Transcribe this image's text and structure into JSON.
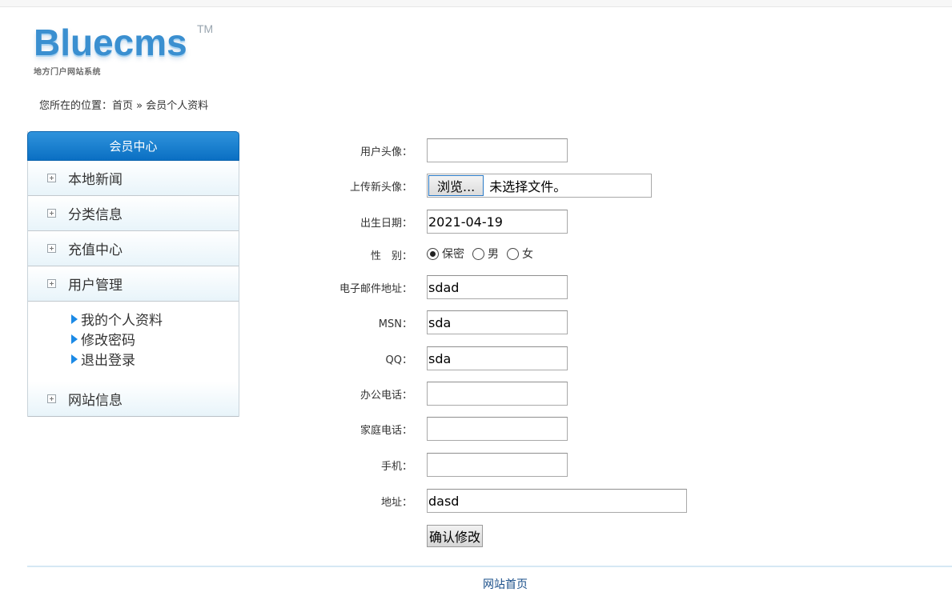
{
  "logo": {
    "word": "Bluecms",
    "tm": "TM",
    "subtitle": "地方门户网站系统"
  },
  "breadcrumb": {
    "prefix": "您所在的位置：",
    "home": "首页",
    "sep": " » ",
    "current": "会员个人资料"
  },
  "sidebar": {
    "title": "会员中心",
    "items": [
      {
        "label": "本地新闻"
      },
      {
        "label": "分类信息"
      },
      {
        "label": "充值中心"
      },
      {
        "label": "用户管理"
      }
    ],
    "sub_links": [
      {
        "label": "我的个人资料"
      },
      {
        "label": "修改密码"
      },
      {
        "label": "退出登录"
      }
    ],
    "last_item": {
      "label": "网站信息"
    }
  },
  "form": {
    "avatar": {
      "label": "用户头像：",
      "value": ""
    },
    "upload": {
      "label": "上传新头像：",
      "button": "浏览...",
      "status": "未选择文件。"
    },
    "birthday": {
      "label": "出生日期：",
      "value": "2021-04-19"
    },
    "gender": {
      "label": "性　别：",
      "options": [
        "保密",
        "男",
        "女"
      ],
      "selected": "保密"
    },
    "email": {
      "label": "电子邮件地址：",
      "value": "sdad"
    },
    "msn": {
      "label": "MSN：",
      "value": "sda"
    },
    "qq": {
      "label": "QQ：",
      "value": "sda"
    },
    "office_phone": {
      "label": "办公电话：",
      "value": ""
    },
    "home_phone": {
      "label": "家庭电话：",
      "value": ""
    },
    "mobile": {
      "label": "手机：",
      "value": ""
    },
    "address": {
      "label": "地址：",
      "value": "dasd"
    },
    "submit": "确认修改"
  },
  "footer": {
    "link": "网站首页"
  }
}
